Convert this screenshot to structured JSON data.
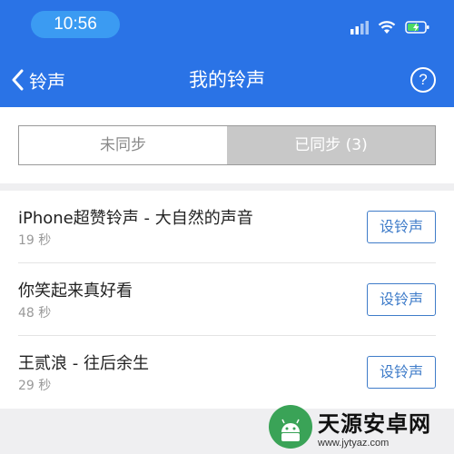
{
  "status_bar": {
    "time": "10:56",
    "icons": [
      "cellular-signal-icon",
      "wifi-icon",
      "battery-charging-icon"
    ]
  },
  "nav": {
    "back_label": "铃声",
    "title": "我的铃声",
    "help_symbol": "?"
  },
  "tabs": {
    "unsynced": "未同步",
    "synced": "已同步 (3)"
  },
  "ringtones": [
    {
      "title": "iPhone超赞铃声 - 大自然的声音",
      "duration": "19 秒",
      "action": "设铃声"
    },
    {
      "title": "你笑起来真好看",
      "duration": "48 秒",
      "action": "设铃声"
    },
    {
      "title": "王贰浪 - 往后余生",
      "duration": "29 秒",
      "action": "设铃声"
    }
  ],
  "colors": {
    "header_blue": "#2a73e6",
    "button_blue": "#3f7cc9",
    "time_pill": "#3b9bf2",
    "battery_green": "#4cd964"
  },
  "watermark": {
    "name": "天源安卓网",
    "url": "www.jytyaz.com"
  }
}
